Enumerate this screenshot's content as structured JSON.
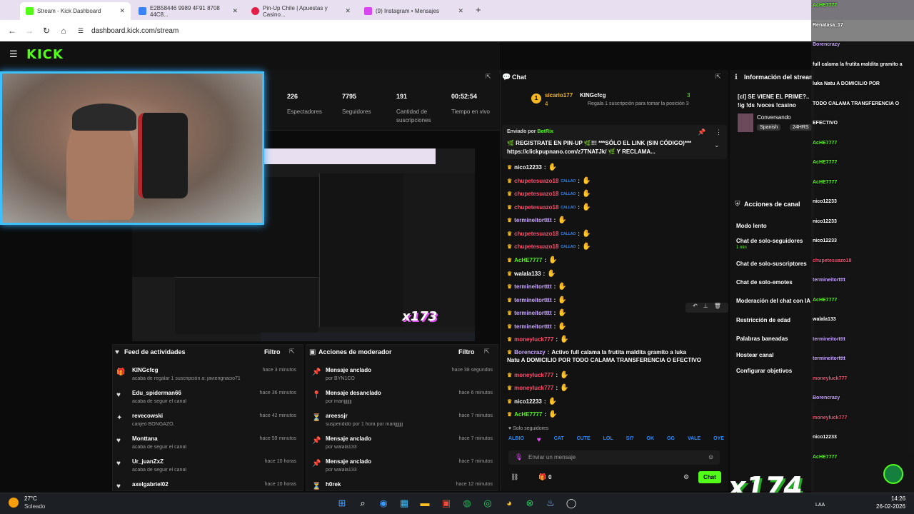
{
  "tabs": [
    {
      "label": "Stream - Kick Dashboard",
      "color": "#53fc18"
    },
    {
      "label": "E2B58446 9989 4F91 8708 44C8...",
      "color": "#3b82f6"
    },
    {
      "label": "Pin-Up Chile | Apuestas y Casino...",
      "color": "#e11d48"
    },
    {
      "label": "(9) Instagram • Mensajes",
      "color": "#d946ef"
    }
  ],
  "url": "dashboard.kick.com/stream",
  "logo": "KICK",
  "stats": [
    {
      "value": "226",
      "label": "Espectadores"
    },
    {
      "value": "7795",
      "label": "Seguidores"
    },
    {
      "value": "191",
      "label": "Cantidad de suscripciones"
    },
    {
      "value": "00:52:54",
      "label": "Tiempo en vivo"
    }
  ],
  "activity": {
    "title": "Feed de actividades",
    "filter": "Filtro",
    "rows": [
      {
        "name": "KINGcfcg",
        "sub": "acaba de regalar 1 suscripción a: javierignacio71",
        "time": "hace 3 minutos",
        "icon": "gift-icon"
      },
      {
        "name": "Edu_spiderman66",
        "sub": "acaba de seguir el canal",
        "time": "hace 36 minutos",
        "icon": "heart-icon"
      },
      {
        "name": "revecowski",
        "sub": "canjeó BONGAZO.",
        "time": "hace 42 minutos",
        "icon": "reward-icon"
      },
      {
        "name": "Monttana",
        "sub": "acaba de seguir el canal",
        "time": "hace 59 minutos",
        "icon": "heart-icon"
      },
      {
        "name": "Ur_juanZxZ",
        "sub": "acaba de seguir el canal",
        "time": "hace 10 horas",
        "icon": "heart-icon"
      },
      {
        "name": "axelgabriel02",
        "sub": "",
        "time": "hace 10 horas",
        "icon": "heart-icon"
      }
    ]
  },
  "modactions": {
    "title": "Acciones de moderador",
    "filter": "Filtro",
    "rows": [
      {
        "name": "Mensaje anclado",
        "sub": "por BYN1CO",
        "time": "hace 38 segundos",
        "icon": "pin-icon"
      },
      {
        "name": "Mensaje desanclado",
        "sub": "por marijjjjjjj",
        "time": "hace 6 minutos",
        "icon": "unpin-icon"
      },
      {
        "name": "areessjr",
        "sub": "suspendido por 1 hora por marijjjjjjj",
        "time": "hace 7 minutos",
        "icon": "hourglass-icon"
      },
      {
        "name": "Mensaje anclado",
        "sub": "por walala133",
        "time": "hace 7 minutos",
        "icon": "pin-icon"
      },
      {
        "name": "Mensaje anclado",
        "sub": "por walala133",
        "time": "hace 7 minutos",
        "icon": "pin-icon"
      },
      {
        "name": "h0rek",
        "sub": "",
        "time": "hace 12 minutos",
        "icon": "hourglass-icon"
      }
    ]
  },
  "chat": {
    "title": "Chat",
    "top": {
      "user1": "sicario177",
      "count1": "4",
      "user2": "KINGcfcg",
      "count2": "3",
      "note": "Regala 1 suscripción para tomar la posición 3"
    },
    "pinned": {
      "by": "Enviado por",
      "author": "BotRix",
      "text": "🌿 REGISTRATE EN PIN-UP 🌿!!! ***SÓLO EL LINK (SIN CÓDIGO)*** https://clickpupnano.com/z7TNATJk/ 🌿 Y RECLAMA..."
    },
    "messages": [
      {
        "user": "nico12233",
        "cls": "user-y",
        "tag": "",
        "text": ""
      },
      {
        "user": "chupetesuazo18",
        "cls": "user-r",
        "tag": "CALLAO",
        "text": ""
      },
      {
        "user": "chupetesuazo18",
        "cls": "user-r",
        "tag": "CALLAO",
        "text": ""
      },
      {
        "user": "chupetesuazo18",
        "cls": "user-r",
        "tag": "CALLAO",
        "text": ""
      },
      {
        "user": "termineitortttt",
        "cls": "user-b",
        "tag": "",
        "text": ""
      },
      {
        "user": "chupetesuazo18",
        "cls": "user-r",
        "tag": "CALLAO",
        "text": ""
      },
      {
        "user": "chupetesuazo18",
        "cls": "user-r",
        "tag": "CALLAO",
        "text": ""
      },
      {
        "user": "AcHE7777",
        "cls": "user-g",
        "tag": "",
        "text": ""
      },
      {
        "user": "walala133",
        "cls": "user-y",
        "tag": "",
        "text": ""
      },
      {
        "user": "termineitortttt",
        "cls": "user-b",
        "tag": "",
        "text": ""
      },
      {
        "user": "termineitortttt",
        "cls": "user-b",
        "tag": "",
        "text": ""
      },
      {
        "user": "termineitortttt",
        "cls": "user-b",
        "tag": "",
        "text": ""
      },
      {
        "user": "termineitortttt",
        "cls": "user-b",
        "tag": "",
        "text": ""
      },
      {
        "user": "moneyluck777",
        "cls": "user-r",
        "tag": "",
        "text": ""
      },
      {
        "user": "Borencrazy",
        "cls": "user-b",
        "tag": "",
        "text": "Activo full calama la frutita maldita gramito a luka"
      },
      {
        "user": "moneyluck777",
        "cls": "user-r",
        "tag": "",
        "text": ""
      },
      {
        "user": "moneyluck777",
        "cls": "user-r",
        "tag": "",
        "text": ""
      },
      {
        "user": "nico12233",
        "cls": "user-y",
        "tag": "",
        "text": ""
      },
      {
        "user": "AcHE7777",
        "cls": "user-g",
        "tag": "",
        "text": ""
      }
    ],
    "borencrazy_line2": "Natu A DOMICILIO POR TODO CALAMA TRANSFERENCIA O EFECTIVO",
    "followers_only": "Solo seguidores",
    "placeholder": "Enviar un mensaje",
    "count": "0",
    "send": "Chat"
  },
  "info": {
    "title": "Información del stream",
    "stream_title": "[cl] SE VIENE EL PRIME?.. !ig !ds !voces !casino",
    "category": "Conversando",
    "lang": "Spanish",
    "tag": "24HRS"
  },
  "channel_actions": {
    "title": "Acciones de canal",
    "items": [
      "Modo lento",
      "Chat de solo-seguidores",
      "Chat de solo-suscriptores",
      "Chat de solo-emotes",
      "Moderación del chat con IA",
      "Restricción de edad",
      "Palabras baneadas",
      "Hostear canal",
      "Configurar objetivos"
    ],
    "sub": "1 min"
  },
  "overlay": [
    {
      "u": "AcHE7777",
      "c": "#53fc18"
    },
    {
      "u": "Renatasa_17",
      "c": "#fff"
    },
    {
      "u": "Borencrazy",
      "c": "#c9a7ff"
    },
    {
      "u": "full calama la frutita maldita gramito a",
      "c": "#fff"
    },
    {
      "u": "luka Natu A DOMICILIO POR",
      "c": "#fff"
    },
    {
      "u": "TODO CALAMA TRANSFERENCIA O",
      "c": "#fff"
    },
    {
      "u": "EFECTIVO",
      "c": "#fff"
    },
    {
      "u": "AcHE7777",
      "c": "#53fc18"
    },
    {
      "u": "AcHE7777",
      "c": "#53fc18"
    },
    {
      "u": "AcHE7777",
      "c": "#53fc18"
    },
    {
      "u": "nico12233",
      "c": "#fff"
    },
    {
      "u": "nico12233",
      "c": "#fff"
    },
    {
      "u": "nico12233",
      "c": "#fff"
    },
    {
      "u": "chupetesuazo18",
      "c": "#ff4d6d"
    },
    {
      "u": "termineitortttt",
      "c": "#c9a7ff"
    },
    {
      "u": "AcHE7777",
      "c": "#53fc18"
    },
    {
      "u": "walala133",
      "c": "#fff"
    },
    {
      "u": "termineitortttt",
      "c": "#c9a7ff"
    },
    {
      "u": "termineitortttt",
      "c": "#c9a7ff"
    },
    {
      "u": "moneyluck777",
      "c": "#ff4d6d"
    },
    {
      "u": "Borencrazy",
      "c": "#c9a7ff"
    },
    {
      "u": "moneyluck777",
      "c": "#ff4d6d"
    },
    {
      "u": "nico12233",
      "c": "#fff"
    },
    {
      "u": "AcHE7777",
      "c": "#53fc18"
    }
  ],
  "weather": {
    "temp": "27°C",
    "cond": "Soleado"
  },
  "clock": {
    "time": "14:26",
    "date": "26-02-2026",
    "lang": "LAA"
  },
  "x173": "x173",
  "x174": "x174"
}
